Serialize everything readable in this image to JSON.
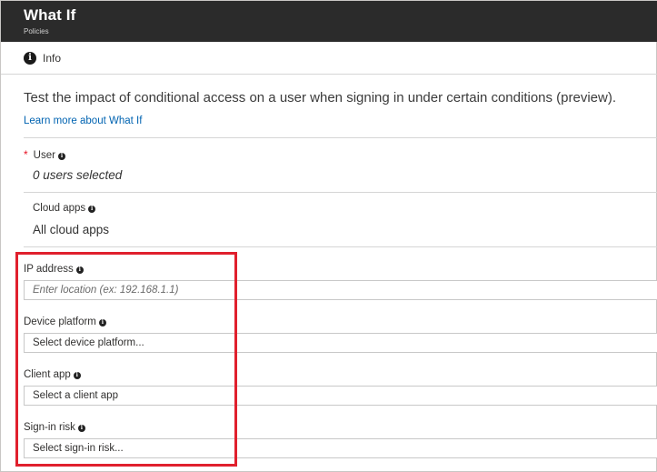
{
  "header": {
    "title": "What If",
    "subtitle": "Policies"
  },
  "toolbar": {
    "info_label": "Info",
    "info_icon": "info-icon"
  },
  "main": {
    "description": "Test the impact of conditional access on a user when signing in under certain conditions (preview).",
    "learn_more": "Learn more about What If",
    "user": {
      "required_mark": "*",
      "label": "User",
      "value": "0 users selected"
    },
    "cloud_apps": {
      "label": "Cloud apps",
      "value": "All cloud apps"
    },
    "ip_address": {
      "label": "IP address",
      "placeholder": "Enter location (ex: 192.168.1.1)"
    },
    "device_platform": {
      "label": "Device platform",
      "value": "Select device platform..."
    },
    "client_app": {
      "label": "Client app",
      "value": "Select a client app"
    },
    "sign_in_risk": {
      "label": "Sign-in risk",
      "value": "Select sign-in risk..."
    }
  },
  "colors": {
    "header_bg": "#2b2b2b",
    "link": "#0063b1",
    "required": "#e81123",
    "highlight_border": "#e0202d"
  }
}
